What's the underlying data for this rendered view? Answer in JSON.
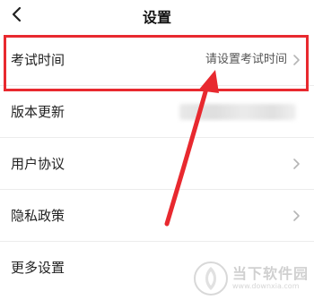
{
  "header": {
    "title": "设置",
    "back_icon": "chevron-left-icon"
  },
  "settings": {
    "items": [
      {
        "label": "考试时间",
        "value": "请设置考试时间",
        "has_chevron": true
      },
      {
        "label": "版本更新",
        "value": "",
        "has_chevron": false
      },
      {
        "label": "用户协议",
        "value": "",
        "has_chevron": true
      },
      {
        "label": "隐私政策",
        "value": "",
        "has_chevron": true
      },
      {
        "label": "更多设置",
        "value": "",
        "has_chevron": false
      }
    ]
  },
  "annotation": {
    "color": "#e8292f"
  },
  "watermark": {
    "text": "当下软件园",
    "url": "www.downxia.com"
  }
}
